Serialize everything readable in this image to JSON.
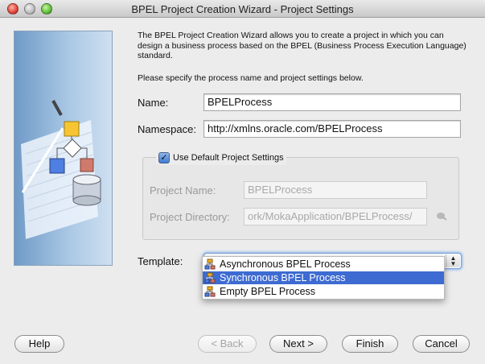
{
  "window": {
    "title": "BPEL Project Creation Wizard - Project Settings"
  },
  "intro": {
    "description": "The BPEL Project Creation Wizard allows you to create a project in which you can design a business process based on the BPEL (Business Process Execution Language) standard.",
    "prompt": "Please specify the process name and project settings below."
  },
  "form": {
    "name_label": "Name:",
    "name_value": "BPELProcess",
    "namespace_label": "Namespace:",
    "namespace_value": "http://xmlns.oracle.com/BPELProcess",
    "use_default_label": "Use Default Project Settings",
    "use_default_checked": true,
    "project_name_label": "Project Name:",
    "project_name_value": "BPELProcess",
    "project_directory_label": "Project Directory:",
    "project_directory_value": "ork/MokaApplication/BPELProcess/",
    "template_label": "Template:",
    "template_options": [
      "Asynchronous BPEL Process",
      "Synchronous BPEL Process",
      "Empty BPEL Process"
    ],
    "template_highlighted_index": 1
  },
  "buttons": {
    "help": "Help",
    "back": "< Back",
    "next": "Next >",
    "finish": "Finish",
    "cancel": "Cancel"
  },
  "colors": {
    "selection": "#3e6bd1",
    "focus_ring": "#8ab4ef",
    "close": "#e0443a",
    "maximize": "#5fbf3a"
  }
}
